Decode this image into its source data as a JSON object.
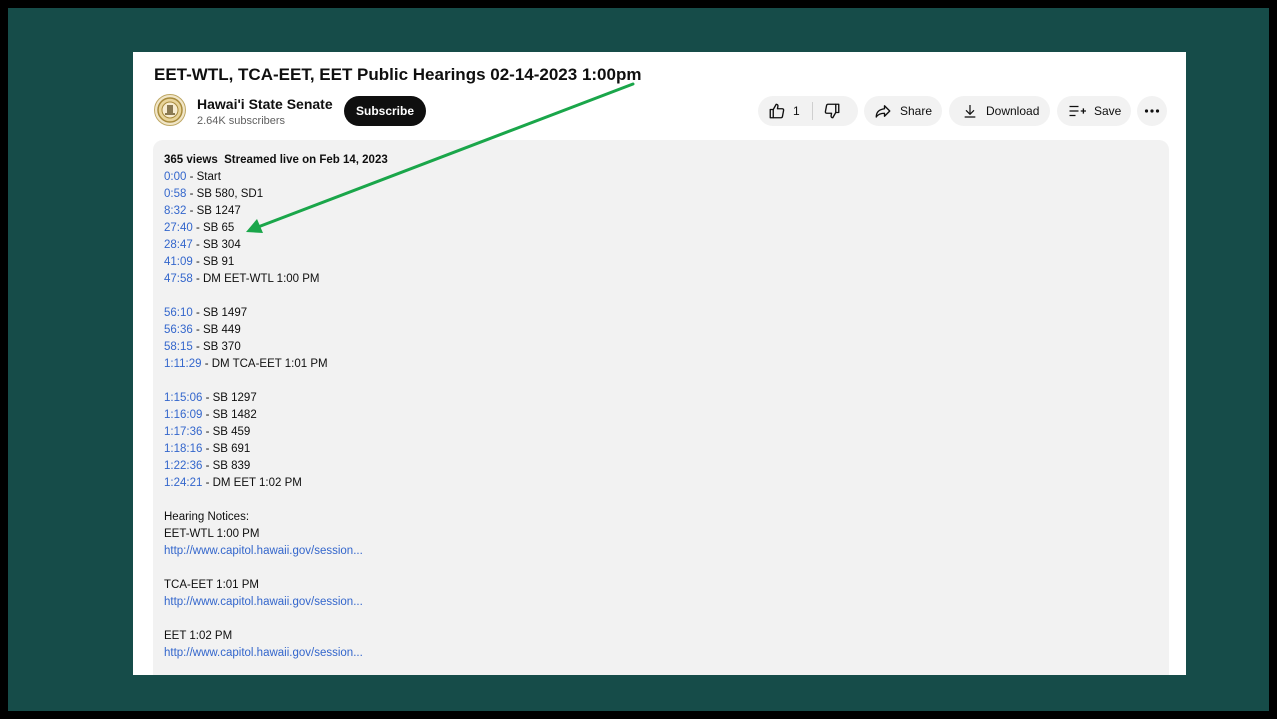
{
  "video": {
    "title": "EET-WTL, TCA-EET, EET Public Hearings 02-14-2023 1:00pm"
  },
  "channel": {
    "name": "Hawai'i State Senate",
    "subscribers": "2.64K subscribers",
    "subscribe_label": "Subscribe",
    "avatar_icon": "state-seal-icon"
  },
  "actions": {
    "like_count": "1",
    "like_icon": "thumbs-up-icon",
    "dislike_icon": "thumbs-down-icon",
    "share_label": "Share",
    "download_label": "Download",
    "save_label": "Save",
    "more_icon": "more-horizontal-icon"
  },
  "description": {
    "views": "365 views",
    "streamed": "Streamed live on Feb 14, 2023",
    "chapter_groups": [
      [
        {
          "ts": "0:00",
          "text": " - Start"
        },
        {
          "ts": "0:58",
          "text": " - SB 580, SD1"
        },
        {
          "ts": "8:32",
          "text": " - SB 1247"
        },
        {
          "ts": "27:40",
          "text": " - SB 65"
        },
        {
          "ts": "28:47",
          "text": " - SB 304"
        },
        {
          "ts": "41:09",
          "text": " - SB 91"
        },
        {
          "ts": "47:58",
          "text": " - DM EET-WTL 1:00 PM"
        }
      ],
      [
        {
          "ts": "56:10",
          "text": " - SB 1497"
        },
        {
          "ts": "56:36",
          "text": " - SB 449"
        },
        {
          "ts": "58:15",
          "text": " - SB 370"
        },
        {
          "ts": "1:11:29",
          "text": " - DM TCA-EET 1:01 PM"
        }
      ],
      [
        {
          "ts": "1:15:06",
          "text": " - SB 1297"
        },
        {
          "ts": "1:16:09",
          "text": " - SB 1482"
        },
        {
          "ts": "1:17:36",
          "text": " - SB 459"
        },
        {
          "ts": "1:18:16",
          "text": " - SB 691"
        },
        {
          "ts": "1:22:36",
          "text": " - SB 839"
        },
        {
          "ts": "1:24:21",
          "text": " - DM EET 1:02 PM"
        }
      ]
    ],
    "notices_heading": "Hearing Notices:",
    "notices": [
      {
        "label": "EET-WTL 1:00 PM",
        "url": "http://www.capitol.hawaii.gov/session..."
      },
      {
        "label": "TCA-EET 1:01 PM",
        "url": "http://www.capitol.hawaii.gov/session..."
      },
      {
        "label": "EET 1:02 PM",
        "url": "http://www.capitol.hawaii.gov/session..."
      }
    ]
  },
  "annotation": {
    "arrow_color": "#1aa64a",
    "arrow_target": "28:47 - SB 304"
  },
  "colors": {
    "frame_background": "#164c49",
    "timestamp_link": "#3366cc",
    "subscribe_button": "#0f0f0f"
  }
}
